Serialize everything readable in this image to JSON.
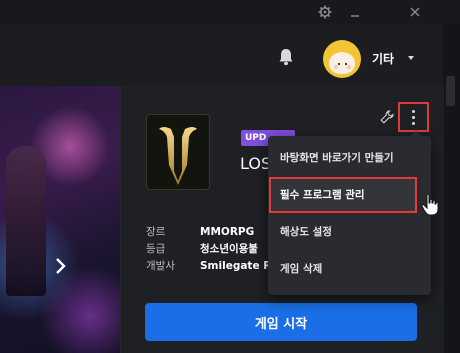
{
  "window": {
    "settings_icon": "gear-icon",
    "minimize_icon": "minimize-icon",
    "close_icon": "close-icon"
  },
  "header": {
    "notification_icon": "bell-icon",
    "user": {
      "name": "기타"
    }
  },
  "game": {
    "badge": "UPD",
    "title": "LOS",
    "info": [
      {
        "label": "장르",
        "value": "MMORPG"
      },
      {
        "label": "등급",
        "value": "청소년이용불"
      },
      {
        "label": "개발사",
        "value": "Smilegate R"
      }
    ],
    "play_label": "게임 시작"
  },
  "context_menu": {
    "items": [
      {
        "label": "바탕화면 바로가기 만들기"
      },
      {
        "label": "필수 프로그램 관리"
      },
      {
        "label": "해상도 설정"
      },
      {
        "label": "게임 삭제"
      }
    ],
    "highlighted_index": 1,
    "highlight_color": "#e23b3b"
  },
  "colors": {
    "primary": "#1a6fe6",
    "badge": "#7e4fe0"
  }
}
